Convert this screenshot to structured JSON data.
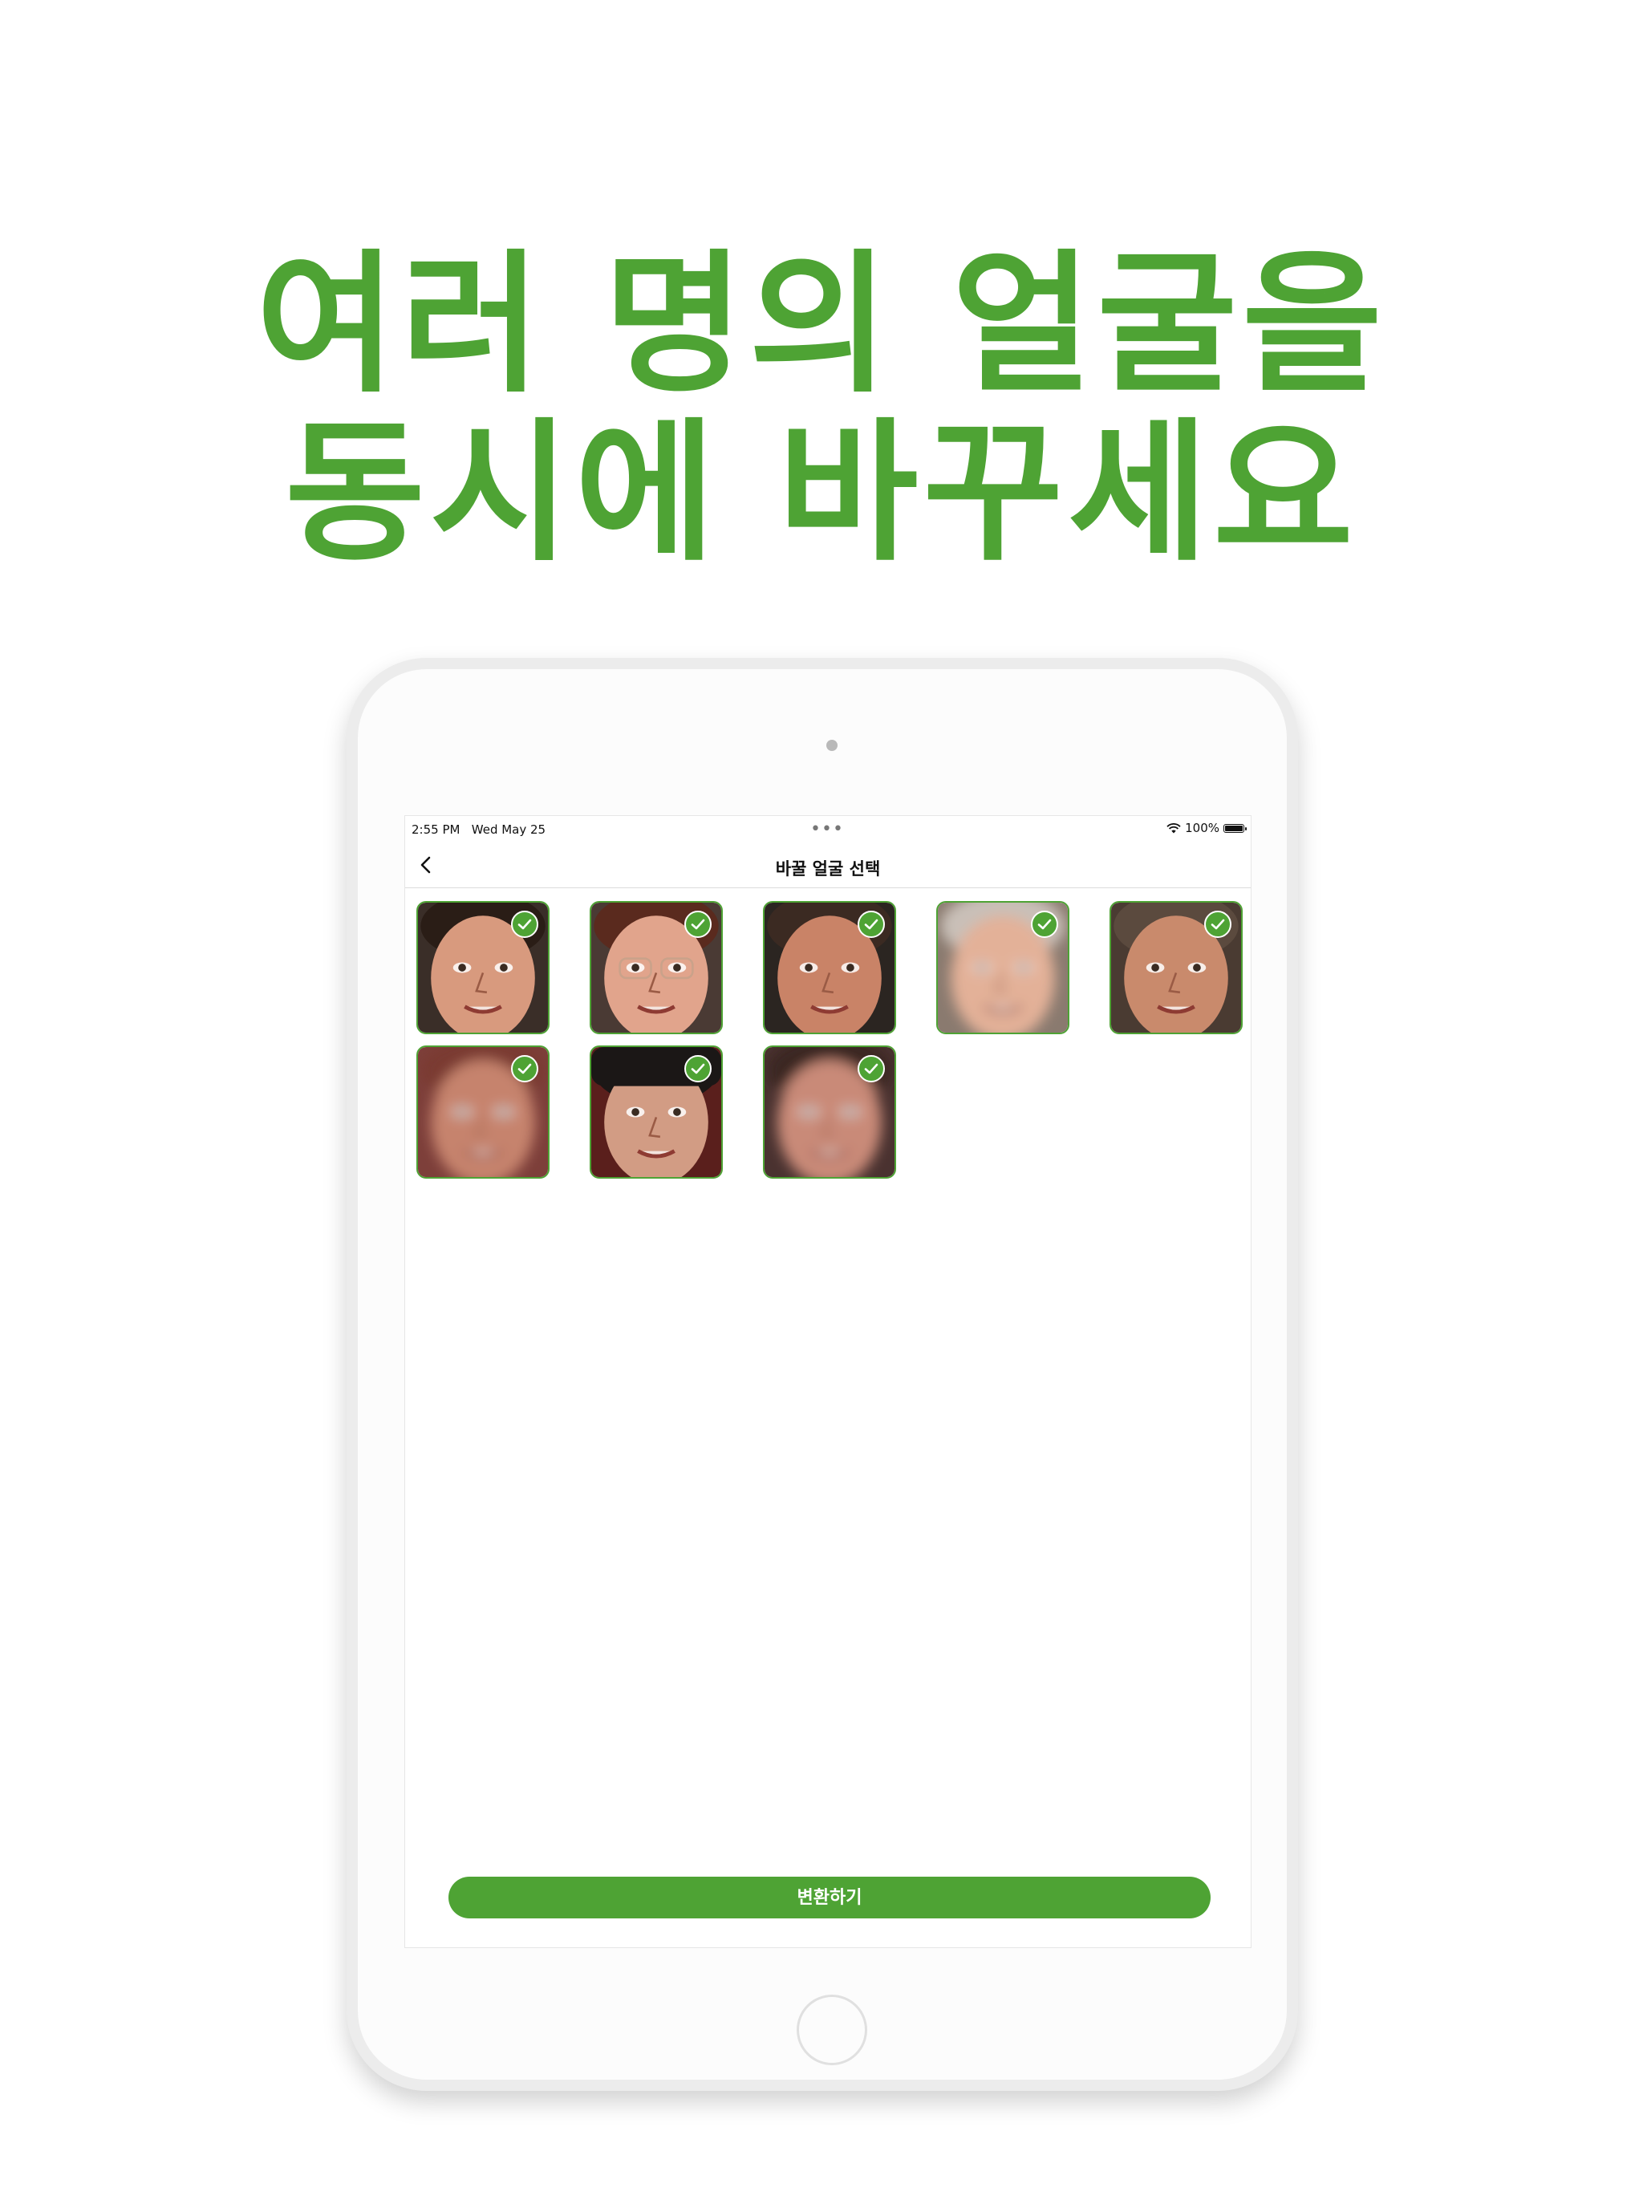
{
  "headline": {
    "line1": "여러 명의 얼굴을",
    "line2": "동시에 바꾸세요"
  },
  "colors": {
    "accent": "#4ea334"
  },
  "status_bar": {
    "time": "2:55 PM",
    "date": "Wed May 25",
    "battery": "100%"
  },
  "nav": {
    "title": "바꿀 얼굴 선택",
    "back_icon": "chevron-left-icon"
  },
  "faces": [
    {
      "selected": true,
      "skin": "#d89a7e",
      "hair": "#2a1d16",
      "bg": "#3a2e28",
      "blur": false
    },
    {
      "selected": true,
      "skin": "#e1a48c",
      "hair": "#5a2a1e",
      "bg": "#4a3a34",
      "blur": false,
      "glasses": true
    },
    {
      "selected": true,
      "skin": "#c98367",
      "hair": "#3b2a22",
      "bg": "#2b2521",
      "blur": false
    },
    {
      "selected": true,
      "skin": "#e3b198",
      "hair": "#c9c0b8",
      "bg": "#8a7a6f",
      "blur": true
    },
    {
      "selected": true,
      "skin": "#c98a6c",
      "hair": "#5b4a3e",
      "bg": "#4a3b32",
      "blur": false
    },
    {
      "selected": true,
      "skin": "#c6836d",
      "hair": "#7a3b33",
      "bg": "#7d3f3a",
      "blur": true
    },
    {
      "selected": true,
      "skin": "#d29c84",
      "hair": "#1b1716",
      "bg": "#5a1f1c",
      "blur": false,
      "hat": true
    },
    {
      "selected": true,
      "skin": "#c98a78",
      "hair": "#3a2624",
      "bg": "#4a3230",
      "blur": true
    }
  ],
  "actions": {
    "convert": "변환하기"
  }
}
